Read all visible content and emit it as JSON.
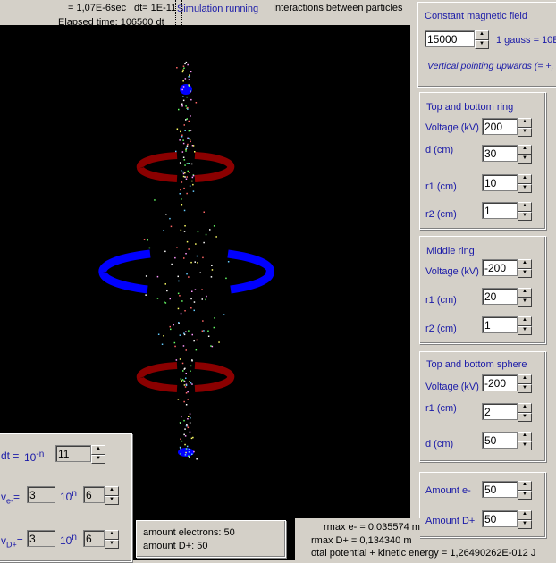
{
  "header": {
    "time": "= 1,07E-6sec",
    "dt": "dt= 1E-11",
    "status": "Simulation running",
    "title": "Interactions between particles",
    "elapsed": "Elapsed time: 106500 dt"
  },
  "magnetic": {
    "title": "Constant magnetic field",
    "value": "15000",
    "unit": "1 gauss = 10E",
    "note": "Vertical pointing upwards (= +,"
  },
  "top_bottom_ring": {
    "title": "Top and bottom ring",
    "voltage_label": "Voltage (kV)",
    "voltage": "200",
    "d_label": "d (cm)",
    "d": "30",
    "r1_label": "r1 (cm)",
    "r1": "10",
    "r2_label": "r2 (cm)",
    "r2": "1"
  },
  "middle_ring": {
    "title": "Middle ring",
    "voltage_label": "Voltage (kV)",
    "voltage": "-200",
    "r1_label": "r1 (cm)",
    "r1": "20",
    "r2_label": "r2 (cm)",
    "r2": "1"
  },
  "sphere": {
    "title": "Top and bottom sphere",
    "voltage_label": "Voltage (kV)",
    "voltage": "-200",
    "r1_label": "r1 (cm)",
    "r1": "2",
    "d_label": "d (cm)",
    "d": "50"
  },
  "amounts": {
    "e_label": "Amount e-",
    "e": "50",
    "d_label": "Amount D+",
    "d": "50"
  },
  "params": {
    "dt_label": "dt =",
    "dt_base": "10",
    "dt_exp": "-n",
    "dt_n": "11",
    "ve_label": "v",
    "ve_sub": "e-",
    "ve_eq": "=",
    "ve_val": "3",
    "ve_base": "10",
    "ve_exp": "n",
    "ve_n": "6",
    "vd_label": "v",
    "vd_sub": "D+",
    "vd_eq": "=",
    "vd_val": "3",
    "vd_base": "10",
    "vd_exp": "n",
    "vd_n": "6"
  },
  "stats": {
    "electrons": "amount electrons: 50",
    "deuterons": "amount D+: 50",
    "rmax_e": "rmax e-  = 0,035574 m",
    "rmax_d": "rmax D+ = 0,134340 m",
    "energy": "otal potential + kinetic energy = 1,26490262E-012 J"
  },
  "arrows": {
    "up": "▲",
    "down": "▼"
  }
}
